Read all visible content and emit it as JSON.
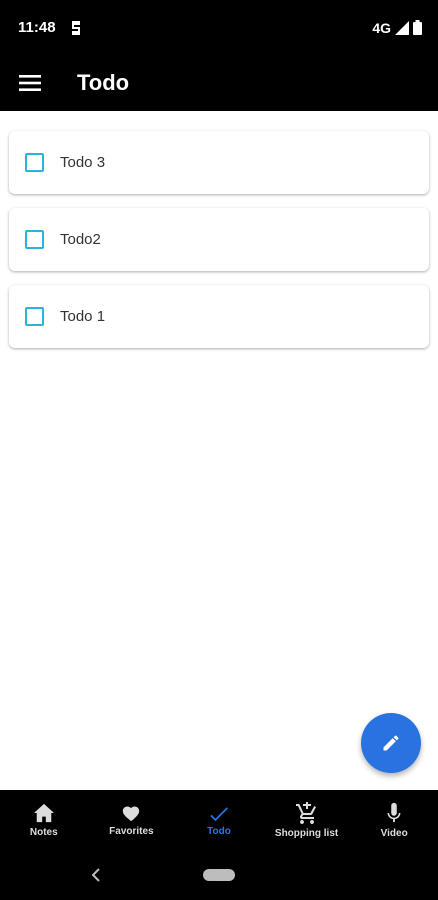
{
  "status_bar": {
    "time": "11:48",
    "network": "4G"
  },
  "app_bar": {
    "title": "Todo"
  },
  "todos": [
    {
      "label": "Todo 3",
      "checked": false
    },
    {
      "label": "Todo2",
      "checked": false
    },
    {
      "label": "Todo 1",
      "checked": false
    }
  ],
  "bottom_nav": {
    "items": [
      {
        "label": "Notes",
        "icon": "home-icon"
      },
      {
        "label": "Favorites",
        "icon": "heart-icon"
      },
      {
        "label": "Todo",
        "icon": "check-icon",
        "active": true
      },
      {
        "label": "Shopping list",
        "icon": "cart-icon"
      },
      {
        "label": "Video",
        "icon": "mic-icon"
      }
    ]
  },
  "colors": {
    "accent": "#2a72e0",
    "checkbox": "#2bb3d9",
    "bar": "#000000"
  }
}
